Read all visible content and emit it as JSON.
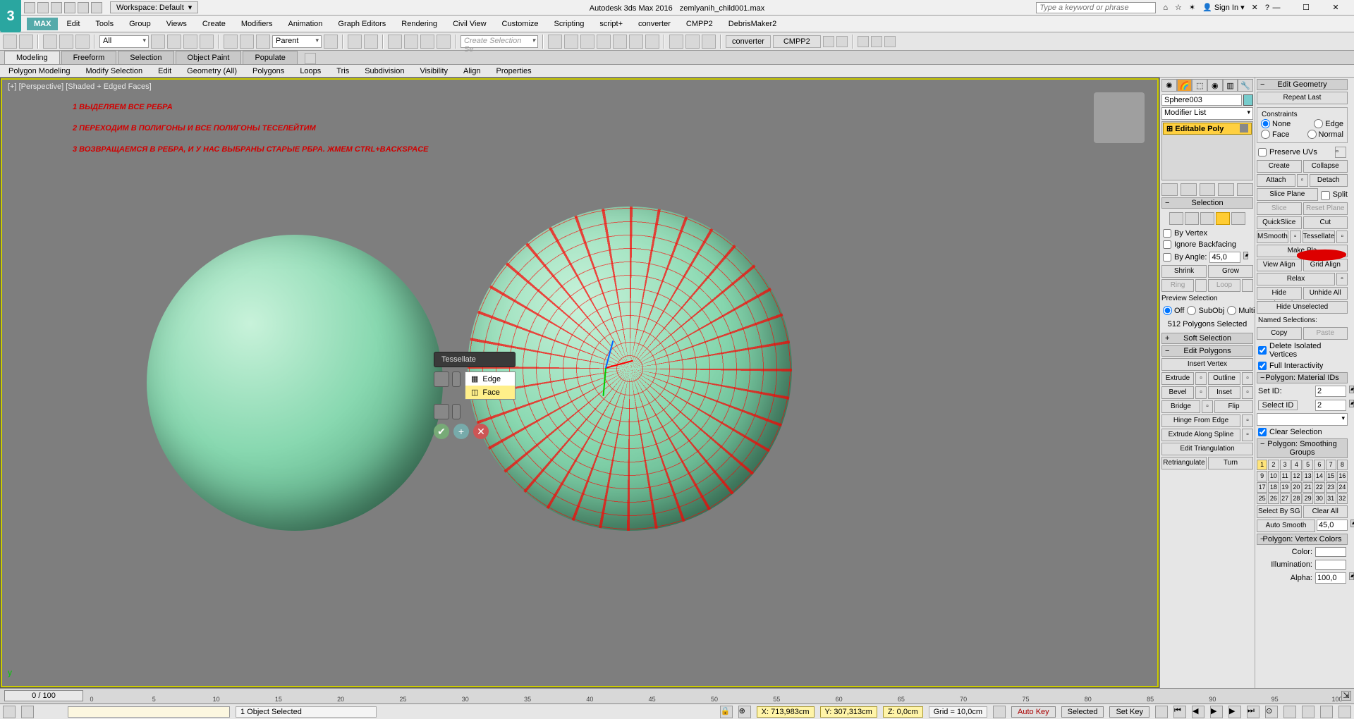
{
  "title": {
    "app": "Autodesk 3ds Max 2016",
    "file": "zemlyanih_child001.max"
  },
  "workspace_label": "Workspace: Default",
  "search_placeholder": "Type a keyword or phrase",
  "sign_in": "Sign In",
  "menus": [
    "MAX",
    "Edit",
    "Tools",
    "Group",
    "Views",
    "Create",
    "Modifiers",
    "Animation",
    "Graph Editors",
    "Rendering",
    "Civil View",
    "Customize",
    "Scripting",
    "script+",
    "converter",
    "CMPP2",
    "DebrisMaker2"
  ],
  "toolbar": {
    "combo_all": "All",
    "combo_parent": "Parent",
    "sel_set": "Create Selection Se"
  },
  "ribbon": {
    "tabs": [
      "Modeling",
      "Freeform",
      "Selection",
      "Object Paint",
      "Populate"
    ],
    "active": 0,
    "sub": [
      "Polygon Modeling",
      "Modify Selection",
      "Edit",
      "Geometry (All)",
      "Polygons",
      "Loops",
      "Tris",
      "Subdivision",
      "Visibility",
      "Align",
      "Properties"
    ]
  },
  "viewport": {
    "label": "[+] [Perspective] [Shaded + Edged Faces]",
    "annot": [
      "1 ВЫДЕЛЯЕМ ВСЕ РЕБРА",
      "2 ПЕРЕХОДИМ В ПОЛИГОНЫ И ВСЕ ПОЛИГОНЫ ТЕСЕЛЕЙТИМ",
      "3 ВОЗВРАЩАЕМСЯ В РЕБРА, И У НАС ВЫБРАНЫ СТАРЫЕ РБРА. ЖМЕМ CTRL+BACKSPACE"
    ],
    "y_axis": "y"
  },
  "caddy": {
    "title": "Tessellate",
    "opts": [
      "Edge",
      "Face"
    ],
    "sel": 1
  },
  "cmd": {
    "obj_name": "Sphere003",
    "mod_list": "Modifier List",
    "mod_item": "Editable Poly",
    "selection": {
      "title": "Selection",
      "by_vertex": "By Vertex",
      "ignore_bf": "Ignore Backfacing",
      "by_angle": "By Angle:",
      "angle": "45,0",
      "shrink": "Shrink",
      "grow": "Grow",
      "ring": "Ring",
      "loop": "Loop",
      "preview": "Preview Selection",
      "off": "Off",
      "subobj": "SubObj",
      "multi": "Multi",
      "count": "512 Polygons Selected"
    },
    "soft": "Soft Selection",
    "edit_polys": {
      "title": "Edit Polygons",
      "insert_vertex": "Insert Vertex",
      "extrude": "Extrude",
      "outline": "Outline",
      "bevel": "Bevel",
      "inset": "Inset",
      "bridge": "Bridge",
      "flip": "Flip",
      "hinge": "Hinge From Edge",
      "ex_spline": "Extrude Along Spline",
      "edit_tri": "Edit Triangulation",
      "retri": "Retriangulate",
      "turn": "Turn"
    },
    "edit_geo": {
      "title": "Edit Geometry",
      "repeat": "Repeat Last",
      "constraints": "Constraints",
      "none": "None",
      "edge": "Edge",
      "face": "Face",
      "normal": "Normal",
      "preserve": "Preserve UVs",
      "create": "Create",
      "collapse": "Collapse",
      "attach": "Attach",
      "detach": "Detach",
      "slice_plane": "Slice Plane",
      "split": "Split",
      "slice": "Slice",
      "reset_plane": "Reset Plane",
      "quickslice": "QuickSlice",
      "cut": "Cut",
      "msmooth": "MSmooth",
      "tess": "Tessellate",
      "make_planar": "Make Pla",
      "view_align": "View Align",
      "grid_align": "Grid Align",
      "relax": "Relax",
      "hide_sel": "Hide Selected",
      "unhide": "Unhide All",
      "hide_unsel": "Hide Unselected",
      "named": "Named Selections:",
      "copy": "Copy",
      "paste": "Paste",
      "del_iso": "Delete Isolated Vertices",
      "full_int": "Full Interactivity"
    },
    "matid": {
      "title": "Polygon: Material IDs",
      "set": "Set ID:",
      "sel": "Select ID",
      "val": "2",
      "clear": "Clear Selection"
    },
    "smooth": {
      "title": "Polygon: Smoothing Groups",
      "sel_by": "Select By SG",
      "clear": "Clear All",
      "auto": "Auto Smooth",
      "auto_val": "45,0"
    },
    "vcol": {
      "title": "Polygon: Vertex Colors",
      "color": "Color:",
      "illum": "Illumination:",
      "alpha": "Alpha:",
      "alpha_val": "100,0"
    }
  },
  "timeline": {
    "handle": "0 / 100"
  },
  "status": {
    "sel": "1 Object Selected",
    "x": "X: 713,983cm",
    "y": "Y: 307,313cm",
    "z": "Z: 0,0cm",
    "grid": "Grid = 10,0cm",
    "autokey": "Auto Key",
    "setkey": "Set Key",
    "selected": "Selected"
  }
}
